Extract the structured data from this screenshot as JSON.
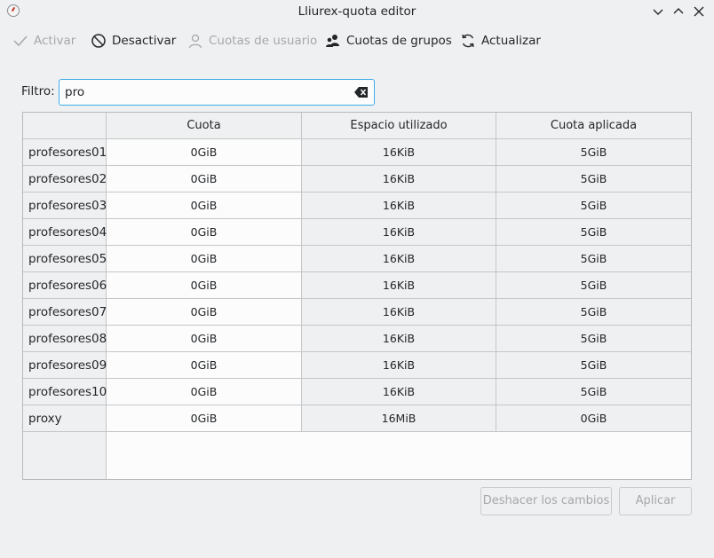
{
  "window": {
    "title": "Lliurex-quota editor"
  },
  "toolbar": {
    "activar": "Activar",
    "desactivar": "Desactivar",
    "cuotas_usuario": "Cuotas de usuario",
    "cuotas_grupos": "Cuotas de grupos",
    "actualizar": "Actualizar"
  },
  "filter": {
    "label": "Filtro:",
    "value": "pro"
  },
  "table": {
    "headers": [
      "Cuota",
      "Espacio utilizado",
      "Cuota aplicada"
    ],
    "rows": [
      {
        "name": "profesores01",
        "cuota": "0GiB",
        "espacio": "16KiB",
        "aplicada": "5GiB"
      },
      {
        "name": "profesores02",
        "cuota": "0GiB",
        "espacio": "16KiB",
        "aplicada": "5GiB"
      },
      {
        "name": "profesores03",
        "cuota": "0GiB",
        "espacio": "16KiB",
        "aplicada": "5GiB"
      },
      {
        "name": "profesores04",
        "cuota": "0GiB",
        "espacio": "16KiB",
        "aplicada": "5GiB"
      },
      {
        "name": "profesores05",
        "cuota": "0GiB",
        "espacio": "16KiB",
        "aplicada": "5GiB"
      },
      {
        "name": "profesores06",
        "cuota": "0GiB",
        "espacio": "16KiB",
        "aplicada": "5GiB"
      },
      {
        "name": "profesores07",
        "cuota": "0GiB",
        "espacio": "16KiB",
        "aplicada": "5GiB"
      },
      {
        "name": "profesores08",
        "cuota": "0GiB",
        "espacio": "16KiB",
        "aplicada": "5GiB"
      },
      {
        "name": "profesores09",
        "cuota": "0GiB",
        "espacio": "16KiB",
        "aplicada": "5GiB"
      },
      {
        "name": "profesores10",
        "cuota": "0GiB",
        "espacio": "16KiB",
        "aplicada": "5GiB"
      },
      {
        "name": "proxy",
        "cuota": "0GiB",
        "espacio": "16MiB",
        "aplicada": "0GiB"
      }
    ]
  },
  "buttons": {
    "undo": "Deshacer los cambios",
    "apply": "Aplicar"
  }
}
